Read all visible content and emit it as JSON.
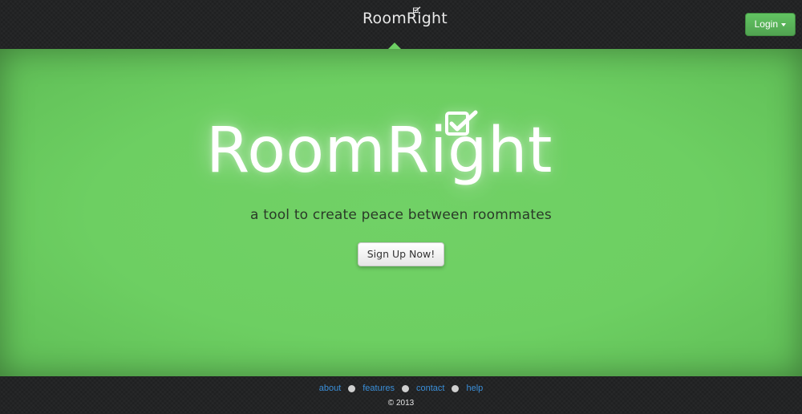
{
  "navbar": {
    "logo_text": "RoomRight",
    "login_label": "Login"
  },
  "hero": {
    "logo_text": "RoomRight",
    "tagline": "a tool to create peace between roommates",
    "signup_label": "Sign Up Now!"
  },
  "footer": {
    "links": [
      "about",
      "features",
      "contact",
      "help"
    ],
    "copyright": "© 2013"
  },
  "icons": {
    "logo_check": "checkbox-check-icon",
    "caret": "caret-down-icon",
    "separator": "dot-separator"
  },
  "colors": {
    "hero_green": "#6dcf62",
    "login_green": "#5cb85c",
    "link_blue": "#3a8fd9",
    "dark_background": "#1f2021"
  }
}
